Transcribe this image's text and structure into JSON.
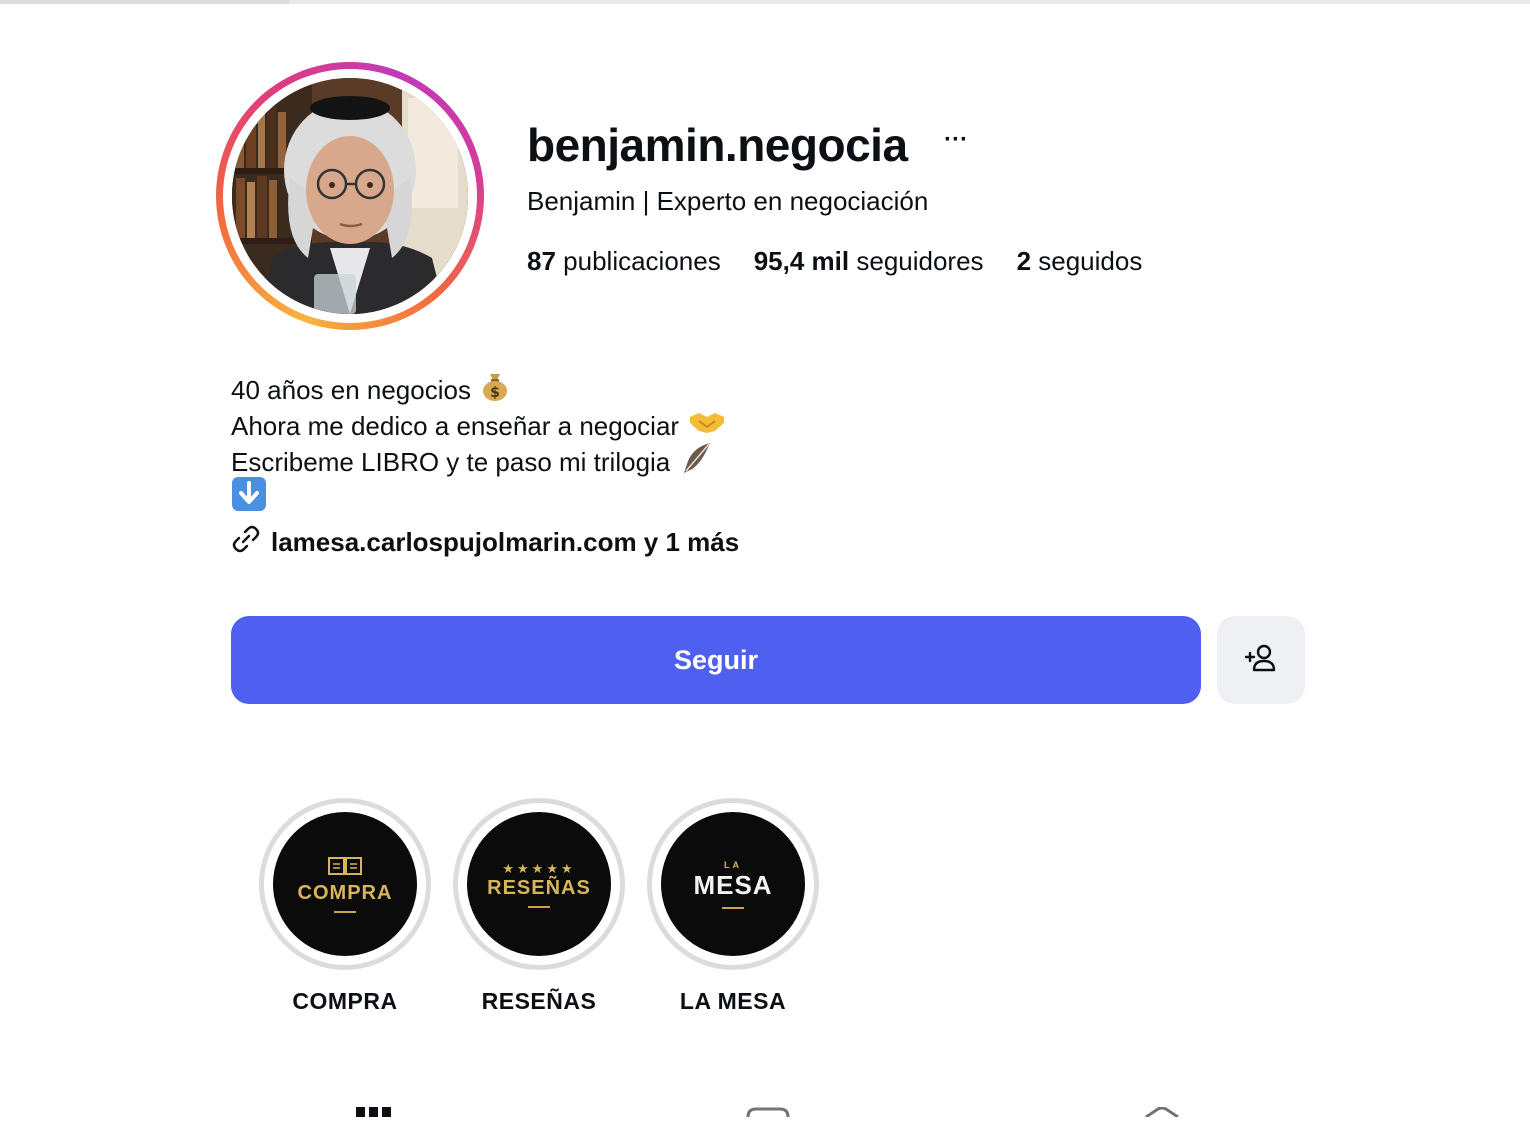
{
  "profile": {
    "username": "benjamin.negocia",
    "full_name": "Benjamin | Experto en negociación",
    "stats": [
      {
        "count": "87",
        "label": "publicaciones"
      },
      {
        "count": "95,4 mil",
        "label": "seguidores"
      },
      {
        "count": "2",
        "label": "seguidos"
      }
    ],
    "bio": [
      {
        "text": "40 años en negocios",
        "emoji": "money-bag-icon"
      },
      {
        "text": "Ahora me dedico a enseñar a negociar",
        "emoji": "handshake-icon"
      },
      {
        "text": "Escribeme LIBRO y te paso mi trilogia",
        "emoji": "feather-icon"
      },
      {
        "text": "",
        "emoji": "down-arrow-icon"
      }
    ],
    "link": "lamesa.carlospujolmarin.com y 1 más",
    "more_label": "···"
  },
  "actions": {
    "follow_label": "Seguir"
  },
  "highlights": [
    {
      "label": "COMPRA",
      "cover_text": "COMPRA",
      "cover_icon": "open-book-icon"
    },
    {
      "label": "RESEÑAS",
      "cover_text": "RESEÑAS",
      "cover_icon": "five-stars",
      "stars": "★★★★★"
    },
    {
      "label": "LA MESA",
      "cover_text": "MESA",
      "cover_small": "LA"
    }
  ],
  "colors": {
    "follow_button": "#4f5ff0",
    "secondary_button": "#eff0f4",
    "gold": "#d9b55a"
  }
}
